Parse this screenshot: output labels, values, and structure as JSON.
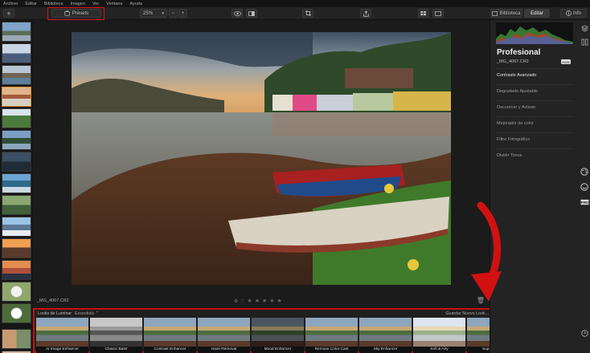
{
  "menu": [
    "Archivo",
    "Editar",
    "Biblioteca",
    "Imagen",
    "Ver",
    "Ventana",
    "Ayuda"
  ],
  "toolbar": {
    "add_label": "+",
    "presets_label": "Presets",
    "zoom_value": "25%",
    "zoom_out": "−",
    "zoom_in": "+",
    "biblioteca_label": "Biblioteca",
    "editar_label": "Editar",
    "info_label": "Info"
  },
  "image": {
    "filename": "_MG_4067.CR2",
    "rating_stars": 0,
    "stars": [
      "★",
      "★",
      "★",
      "★",
      "★"
    ]
  },
  "looks": {
    "tab_label": "Looks de Luminar",
    "essentials_label": "Essentials",
    "save_label": "Guardar Nuevo Look...",
    "items": [
      {
        "label": "AI Image Enhancer",
        "tone": "color"
      },
      {
        "label": "Classic B&W",
        "tone": "bw"
      },
      {
        "label": "Contrast Enhancer",
        "tone": "color"
      },
      {
        "label": "Haze Removal",
        "tone": "color"
      },
      {
        "label": "Mood Enhancer",
        "tone": "dark"
      },
      {
        "label": "Remove Color Cast",
        "tone": "color"
      },
      {
        "label": "Sky Enhancer",
        "tone": "color"
      },
      {
        "label": "Soft & Airy",
        "tone": "light"
      },
      {
        "label": "Super Sharp",
        "tone": "color"
      }
    ]
  },
  "panel": {
    "title": "Profesional",
    "filename": "_MG_4067.CR2",
    "badge": "RAW",
    "filters": [
      {
        "label": "Contraste Avanzado",
        "active": true
      },
      {
        "label": "Degradado Ajustable",
        "active": false
      },
      {
        "label": "Oscurecer y Aclarar",
        "active": false
      },
      {
        "label": "Mejorador de color",
        "active": false
      },
      {
        "label": "Filtro Fotográfico",
        "active": false
      },
      {
        "label": "Dividir Tonos",
        "active": false
      }
    ]
  },
  "colors": {
    "accent_red": "#d11111",
    "panel_bg": "#232323",
    "app_bg": "#1b1b1b"
  }
}
